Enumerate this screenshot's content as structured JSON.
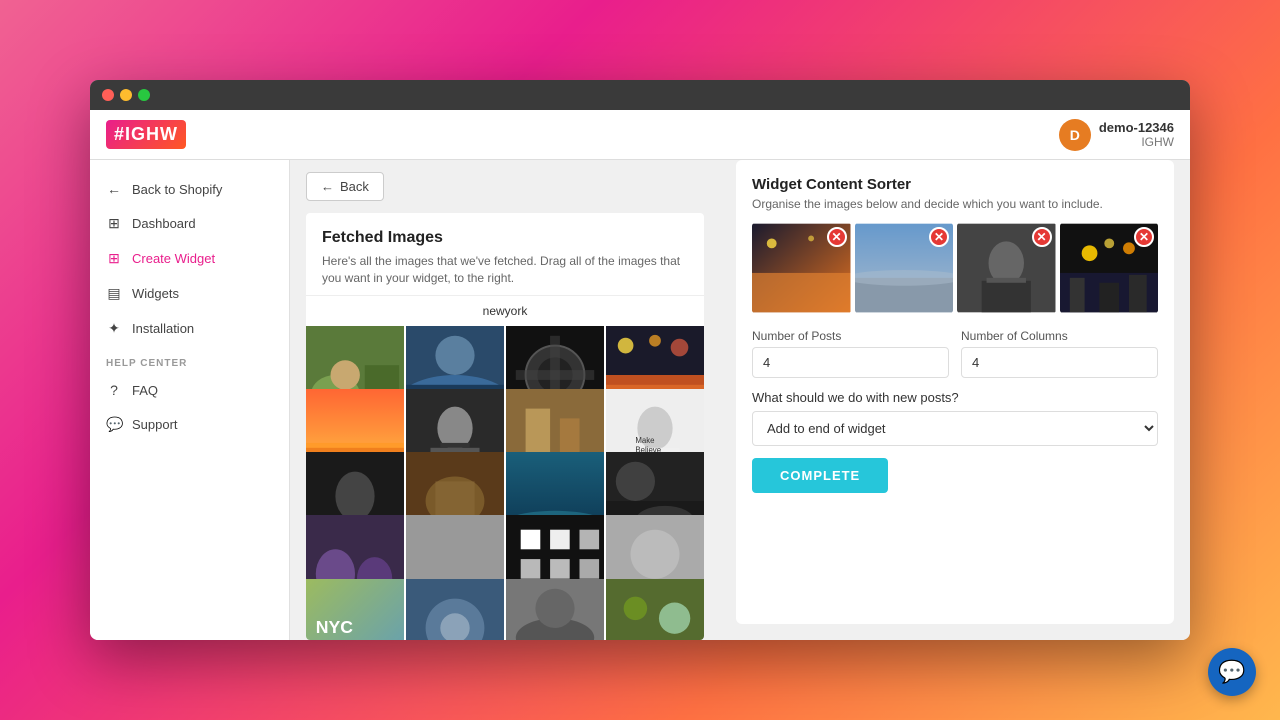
{
  "window": {
    "traffic_lights": [
      "red",
      "yellow",
      "green"
    ]
  },
  "header": {
    "logo_text": "IGHW",
    "logo_hash": "#",
    "user_name": "demo-12346",
    "user_sub": "IGHW",
    "user_initial": "D"
  },
  "sidebar": {
    "nav_items": [
      {
        "id": "back-shopify",
        "label": "Back to Shopify",
        "icon": "←"
      },
      {
        "id": "dashboard",
        "label": "Dashboard",
        "icon": "⊞"
      },
      {
        "id": "create-widget",
        "label": "Create Widget",
        "icon": "⊞"
      },
      {
        "id": "widgets",
        "label": "Widgets",
        "icon": "▤"
      },
      {
        "id": "installation",
        "label": "Installation",
        "icon": "💡"
      }
    ],
    "help_section": "HELP CENTER",
    "help_items": [
      {
        "id": "faq",
        "label": "FAQ",
        "icon": "?"
      },
      {
        "id": "support",
        "label": "Support",
        "icon": "💬"
      }
    ]
  },
  "back_button": "Back",
  "fetched": {
    "title": "Fetched Images",
    "description": "Here's all the images that we've fetched. Drag all of the images that you want in your widget, to the right.",
    "tag": "newyork"
  },
  "widget_sorter": {
    "title": "Widget Content Sorter",
    "description": "Organise the images below and decide which you want to include.",
    "num_posts_label": "Number of Posts",
    "num_posts_value": "4",
    "num_cols_label": "Number of Columns",
    "num_cols_value": "4",
    "new_posts_label": "What should we do with new posts?",
    "new_posts_value": "Add to end of widget",
    "complete_button": "COMPLETE"
  },
  "chat_icon": "💬",
  "grid_colors": [
    [
      "#6d8b4f",
      "#3a6186",
      "#222",
      "#c4775a",
      "#7b5ea7",
      "#3a7d44",
      "#b5451b",
      "#4a90d9",
      "#1a1a2e",
      "#8B7355",
      "#556b2f",
      "#8B4513",
      "#2c3e50",
      "#7f8c8d",
      "#c0392b",
      "#16a085"
    ],
    [
      "sunset_orange",
      "sky_blue",
      "dark_face",
      "white_shirt",
      "citynight",
      "abstract"
    ]
  ],
  "selected_images": [
    {
      "id": "sel1",
      "color": "#e8a87c"
    },
    {
      "id": "sel2",
      "color": "#b0c4de"
    },
    {
      "id": "sel3",
      "color": "#7f8c8d"
    },
    {
      "id": "sel4",
      "color": "#2c2c2c"
    }
  ]
}
